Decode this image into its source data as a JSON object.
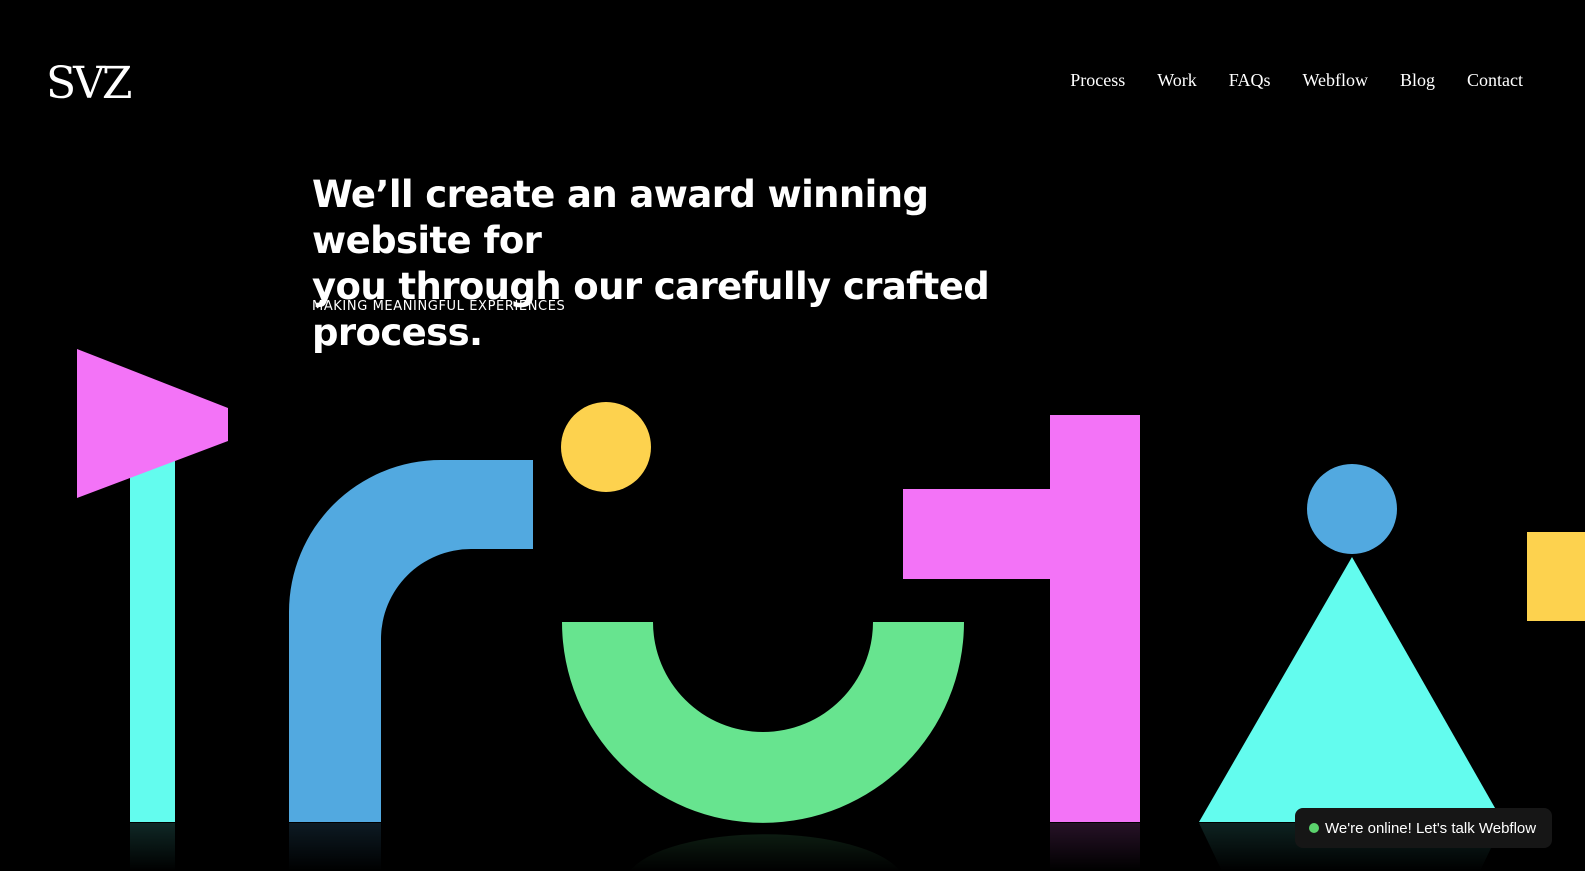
{
  "brand": {
    "logo_text": "SVZ"
  },
  "nav": {
    "items": [
      {
        "label": "Process"
      },
      {
        "label": "Work"
      },
      {
        "label": "FAQs"
      },
      {
        "label": "Webflow"
      },
      {
        "label": "Blog"
      },
      {
        "label": "Contact"
      }
    ]
  },
  "hero": {
    "headline_line1": "We’ll create an award winning website for",
    "headline_line2": "you through our carefully crafted process.",
    "tagline": "MAKING MEANINGFUL EXPERIENCES"
  },
  "chat": {
    "label": "We're online! Let's talk Webflow",
    "status_color": "#5bd36d"
  },
  "colors": {
    "background": "#000000",
    "pink": "#f373f7",
    "cyan": "#63fcee",
    "blue": "#52a9e0",
    "yellow": "#fdd24e",
    "green": "#67e48f"
  }
}
